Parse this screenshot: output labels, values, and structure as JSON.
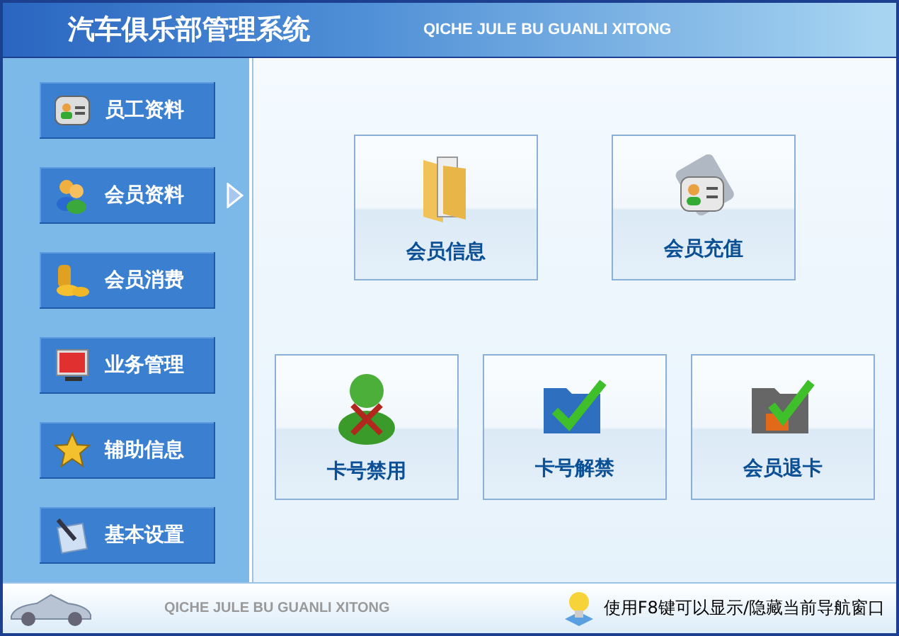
{
  "header": {
    "title": "汽车俱乐部管理系统",
    "subtitle": "QICHE JULE BU GUANLI XITONG"
  },
  "sidebar": {
    "items": [
      {
        "label": "员工资料",
        "selected": false
      },
      {
        "label": "会员资料",
        "selected": true
      },
      {
        "label": "会员消费",
        "selected": false
      },
      {
        "label": "业务管理",
        "selected": false
      },
      {
        "label": "辅助信息",
        "selected": false
      },
      {
        "label": "基本设置",
        "selected": false
      }
    ]
  },
  "tiles": [
    [
      {
        "label": "会员信息"
      },
      {
        "label": "会员充值"
      }
    ],
    [
      {
        "label": "卡号禁用"
      },
      {
        "label": "卡号解禁"
      },
      {
        "label": "会员退卡"
      }
    ]
  ],
  "footer": {
    "subtitle": "QICHE JULE BU GUANLI XITONG",
    "hint": "使用F8键可以显示/隐藏当前导航窗口"
  }
}
